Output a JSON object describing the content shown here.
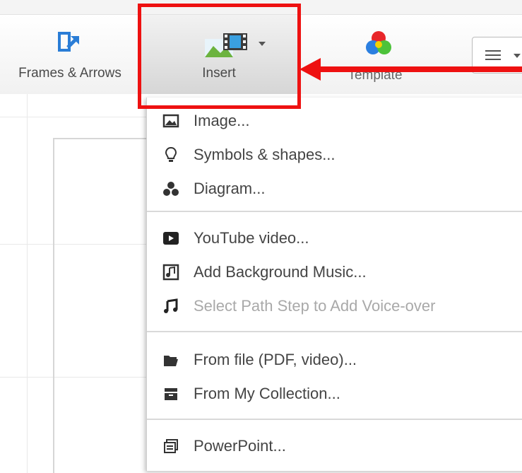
{
  "toolbar": {
    "frames_label": "Frames & Arrows",
    "insert_label": "Insert",
    "template_label": "Template",
    "menu_button_icon": "hamburger-icon"
  },
  "insert_menu": {
    "groups": [
      [
        {
          "label": "Image...",
          "icon": "image-icon",
          "enabled": true
        },
        {
          "label": "Symbols & shapes...",
          "icon": "lightbulb-icon",
          "enabled": true
        },
        {
          "label": "Diagram...",
          "icon": "diagram-icon",
          "enabled": true
        }
      ],
      [
        {
          "label": "YouTube video...",
          "icon": "youtube-icon",
          "enabled": true
        },
        {
          "label": "Add Background Music...",
          "icon": "music-file-icon",
          "enabled": true
        },
        {
          "label": "Select Path Step to Add Voice-over",
          "icon": "music-note-icon",
          "enabled": false
        }
      ],
      [
        {
          "label": "From file (PDF, video)...",
          "icon": "folder-open-icon",
          "enabled": true
        },
        {
          "label": "From My Collection...",
          "icon": "collection-box-icon",
          "enabled": true
        }
      ],
      [
        {
          "label": "PowerPoint...",
          "icon": "powerpoint-icon",
          "enabled": true
        }
      ]
    ]
  },
  "annotation": {
    "highlight_color": "#ee1111",
    "arrow_color": "#ee1111"
  },
  "colors": {
    "frames_icon_blue": "#2a7dd6",
    "insert_icon_green": "#6cb33f",
    "insert_icon_blue": "#3aa0e0"
  }
}
